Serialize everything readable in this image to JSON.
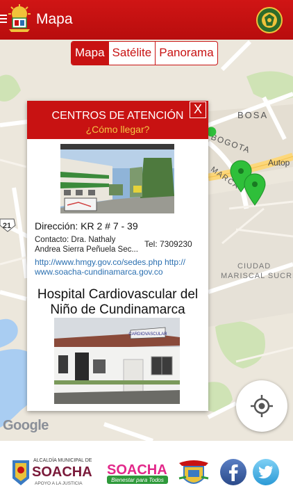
{
  "header": {
    "title": "Mapa"
  },
  "map": {
    "tabs": [
      {
        "label": "Mapa",
        "active": true
      },
      {
        "label": "Satélite",
        "active": false
      },
      {
        "label": "Panorama",
        "active": false
      }
    ],
    "labels": {
      "bosa": "BOSA",
      "bogota": "BOGOTA",
      "autop": "Autop",
      "marca": "MARCA",
      "ciudad_line1": "CIUDAD",
      "ciudad_line2": "MARISCAL SUCRE",
      "road_21": "21",
      "google": "Google"
    }
  },
  "popup": {
    "title": "CENTROS DE ATENCIÓN",
    "subtitle": "¿Cómo llegar?",
    "close": "X",
    "address": "Dirección: KR 2 # 7 - 39",
    "contact_line1": "Contacto: Dra. Nathaly",
    "contact_line2": "Andrea Sierra Peñuela Sec...",
    "tel": "Tel: 7309230",
    "link_line1": "http://www.hmgy.gov.co/sedes.php http://",
    "link_line2": "www.soacha-cundinamarca.gov.co",
    "hospital_line1": "Hospital Cardiovascular del",
    "hospital_line2": "Niño de Cundinamarca",
    "sign_text": "CARDIOVASCULAR"
  },
  "footer": {
    "soacha_logo_text": "SOACHA",
    "soacha_logo_small": "ALCALDÍA MUNICIPAL DE",
    "soacha_logo_sub": "APOYO A LA JUSTICIA",
    "soacha2_text": "SOACHA",
    "soacha2_sub": "Bienestar para Todos"
  },
  "colors": {
    "primary": "#c81212",
    "accent": "#f3c545",
    "link": "#2a6fb0",
    "marker": "#2fbf3a"
  },
  "icons": [
    "menu-icon",
    "crest-icon",
    "police-badge-icon",
    "close-icon",
    "map-marker-icon",
    "my-location-icon",
    "facebook-icon",
    "twitter-icon"
  ]
}
